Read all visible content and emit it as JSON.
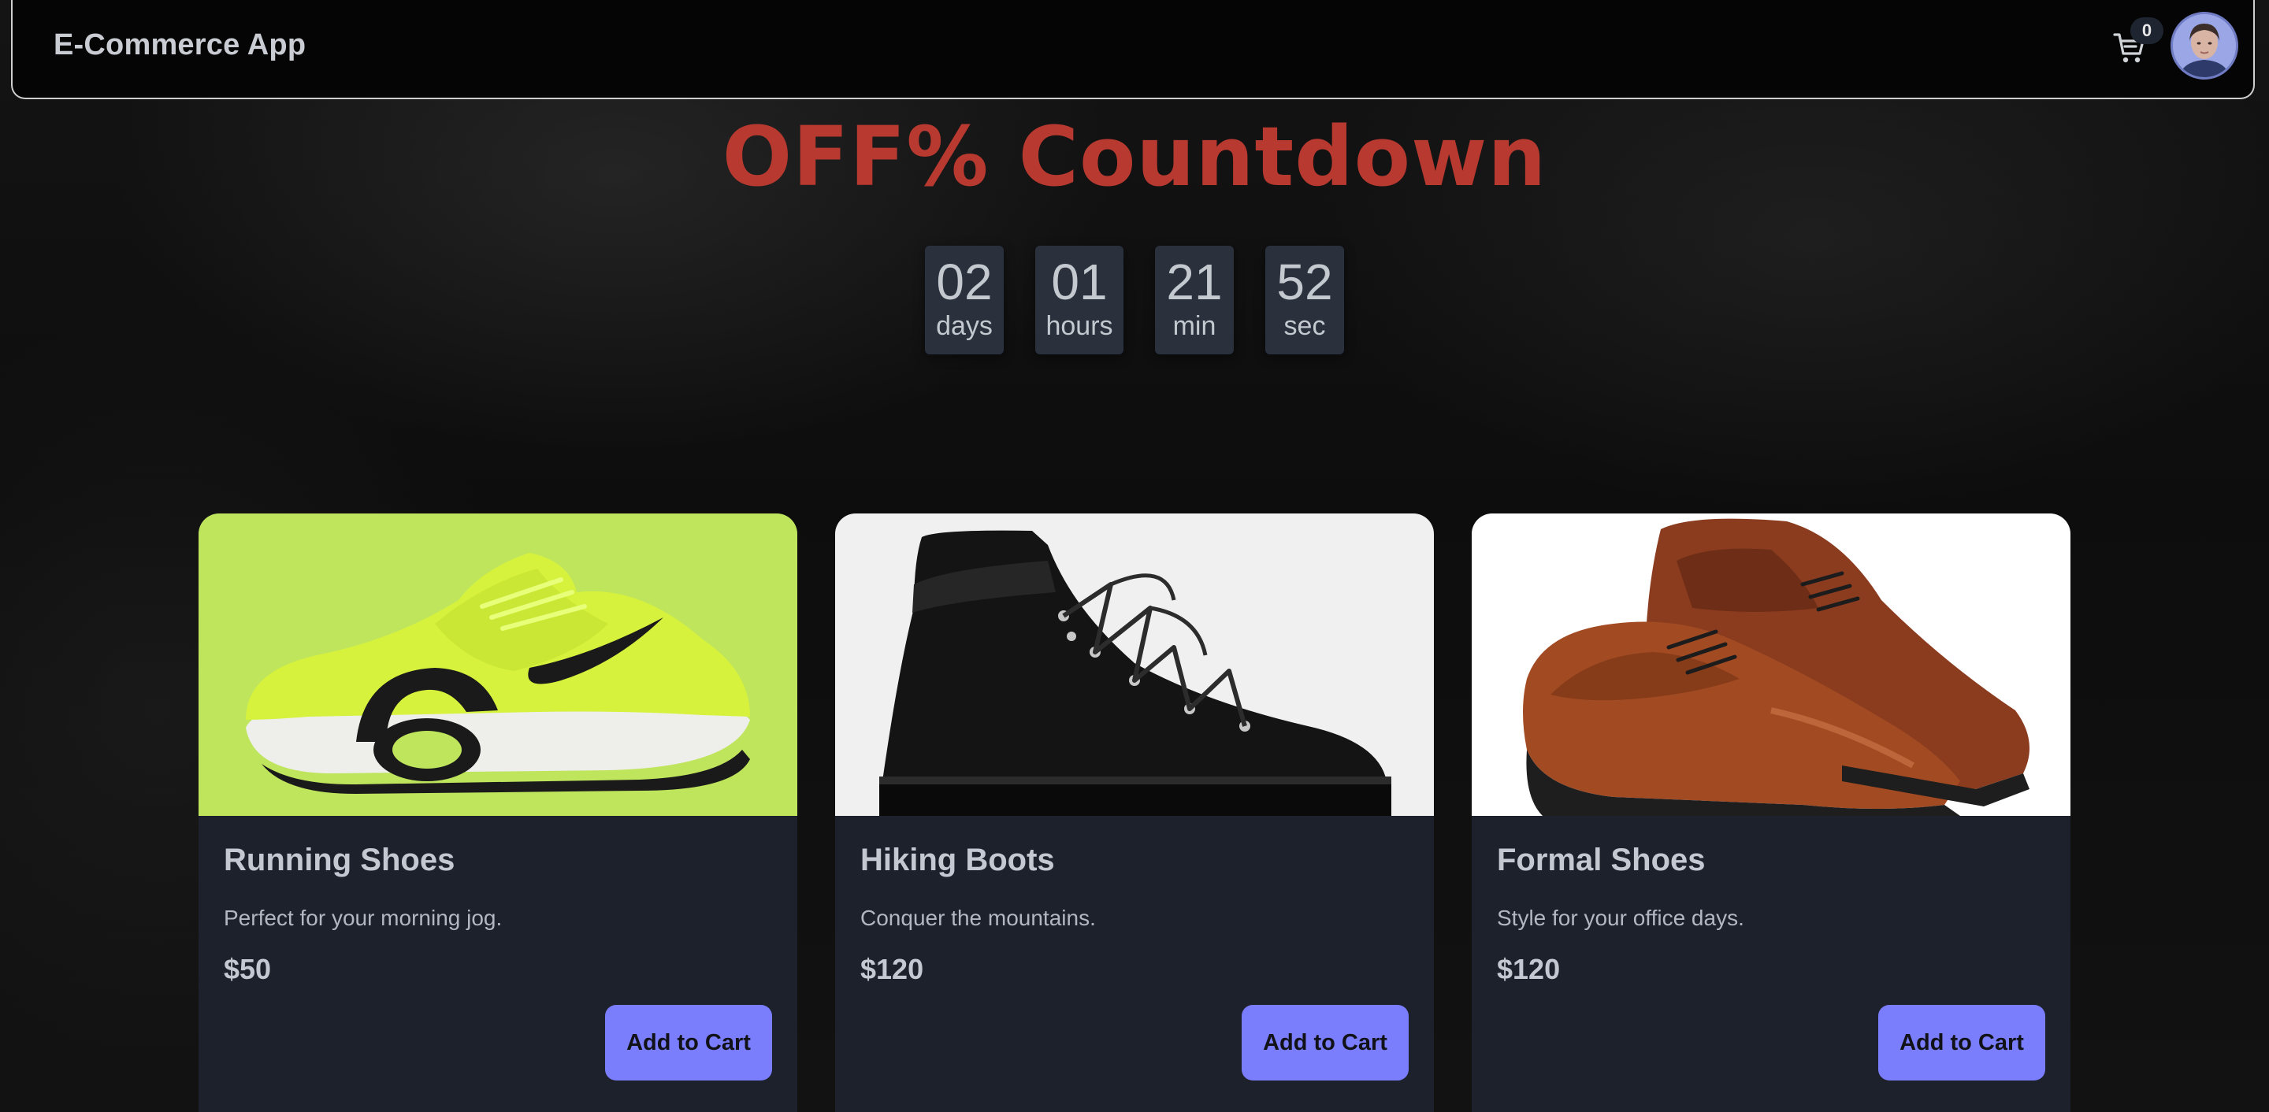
{
  "header": {
    "brand": "E-Commerce App",
    "cart_count": "0",
    "cart_icon": "shopping-cart-icon",
    "avatar_icon": "user-avatar"
  },
  "countdown": {
    "title": "OFF% Countdown",
    "title_color": "#b8392f",
    "units": [
      {
        "value": "02",
        "label": "days"
      },
      {
        "value": "01",
        "label": "hours"
      },
      {
        "value": "21",
        "label": "min"
      },
      {
        "value": "52",
        "label": "sec"
      }
    ]
  },
  "products": [
    {
      "name": "Running Shoes",
      "description": "Perfect for your morning jog.",
      "price": "$50",
      "button": "Add to Cart",
      "image_bg": "#bfe55c"
    },
    {
      "name": "Hiking Boots",
      "description": "Conquer the mountains.",
      "price": "$120",
      "button": "Add to Cart",
      "image_bg": "#f0f0f0"
    },
    {
      "name": "Formal Shoes",
      "description": "Style for your office days.",
      "price": "$120",
      "button": "Add to Cart",
      "image_bg": "#ffffff"
    }
  ],
  "colors": {
    "accent_button": "#7b7efc",
    "card_bg": "#1d212b",
    "countdown_box": "#2a313d"
  }
}
